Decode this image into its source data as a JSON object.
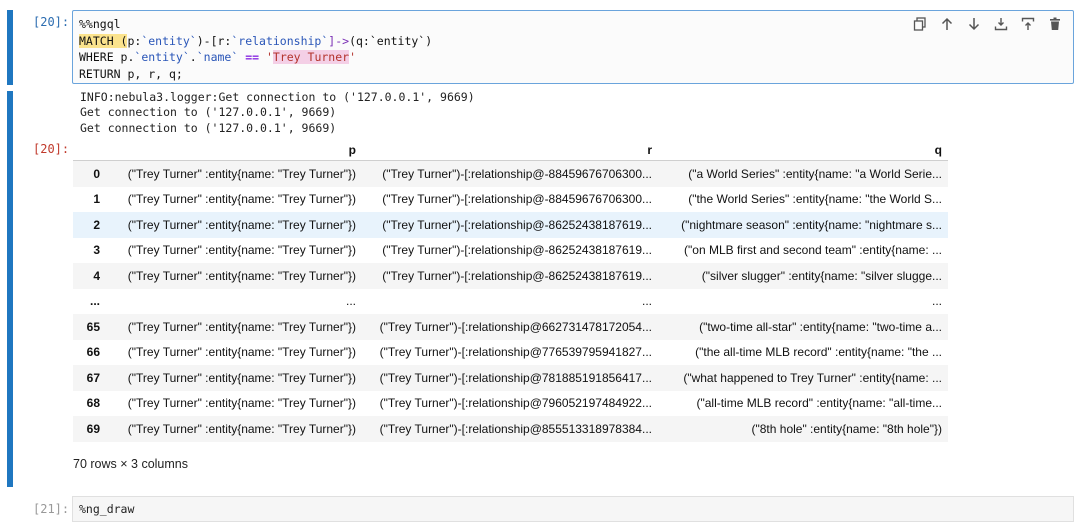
{
  "cell20": {
    "prompt": "[20]:",
    "code": {
      "line1": "%%ngql",
      "line2_match": "MATCH (",
      "line2_p": "p:",
      "line2_entity1": "`entity`",
      "line2_mid": ")-[r:",
      "line2_rel": "`relationship`",
      "line2_arrow": "]->",
      "line2_q": "(q:",
      "line2_entity2": "`entity`",
      "line2_close": ")",
      "line3_where": "WHERE p.",
      "line3_entity": "`entity`",
      "line3_dot": ".",
      "line3_name": "`name`",
      "line3_eq": " == ",
      "line3_q1": "'",
      "line3_value": "Trey Turner",
      "line3_q2": "'",
      "line4": "RETURN p, r, q;"
    },
    "toolbar": {
      "icons": [
        "duplicate-icon",
        "move-up-icon",
        "move-down-icon",
        "insert-above-icon",
        "insert-below-icon",
        "delete-icon"
      ]
    },
    "log": {
      "line1": "INFO:nebula3.logger:Get connection to ('127.0.0.1', 9669)",
      "line2": "Get connection to ('127.0.0.1', 9669)",
      "line3": "Get connection to ('127.0.0.1', 9669)"
    },
    "out_prompt": "[20]:",
    "table": {
      "columns": [
        "",
        "p",
        "r",
        "q"
      ],
      "rows": [
        [
          "0",
          "(\"Trey Turner\" :entity{name: \"Trey Turner\"})",
          "(\"Trey Turner\")-[:relationship@-88459676706300...",
          "(\"a World Series\" :entity{name: \"a World Serie..."
        ],
        [
          "1",
          "(\"Trey Turner\" :entity{name: \"Trey Turner\"})",
          "(\"Trey Turner\")-[:relationship@-88459676706300...",
          "(\"the World Series\" :entity{name: \"the World S..."
        ],
        [
          "2",
          "(\"Trey Turner\" :entity{name: \"Trey Turner\"})",
          "(\"Trey Turner\")-[:relationship@-86252438187619...",
          "(\"nightmare season\" :entity{name: \"nightmare s..."
        ],
        [
          "3",
          "(\"Trey Turner\" :entity{name: \"Trey Turner\"})",
          "(\"Trey Turner\")-[:relationship@-86252438187619...",
          "(\"on MLB first and second team\" :entity{name: ..."
        ],
        [
          "4",
          "(\"Trey Turner\" :entity{name: \"Trey Turner\"})",
          "(\"Trey Turner\")-[:relationship@-86252438187619...",
          "(\"silver slugger\" :entity{name: \"silver slugge..."
        ],
        [
          "...",
          "...",
          "...",
          "..."
        ],
        [
          "65",
          "(\"Trey Turner\" :entity{name: \"Trey Turner\"})",
          "(\"Trey Turner\")-[:relationship@662731478172054...",
          "(\"two-time all-star\" :entity{name: \"two-time a..."
        ],
        [
          "66",
          "(\"Trey Turner\" :entity{name: \"Trey Turner\"})",
          "(\"Trey Turner\")-[:relationship@776539795941827...",
          "(\"the all-time MLB record\" :entity{name: \"the ..."
        ],
        [
          "67",
          "(\"Trey Turner\" :entity{name: \"Trey Turner\"})",
          "(\"Trey Turner\")-[:relationship@781885191856417...",
          "(\"what happened to Trey Turner\" :entity{name: ..."
        ],
        [
          "68",
          "(\"Trey Turner\" :entity{name: \"Trey Turner\"})",
          "(\"Trey Turner\")-[:relationship@796052197484922...",
          "(\"all-time MLB record\" :entity{name: \"all-time..."
        ],
        [
          "69",
          "(\"Trey Turner\" :entity{name: \"Trey Turner\"})",
          "(\"Trey Turner\")-[:relationship@855513318978384...",
          "(\"8th hole\" :entity{name: \"8th hole\"})"
        ]
      ],
      "hover_row_index": 2
    },
    "shape": "70 rows × 3 columns"
  },
  "cell21": {
    "prompt": "[21]:",
    "code": "%ng_draw"
  },
  "colors": {
    "accent": "#1f77c0",
    "hover_row": "#e8f3fc",
    "highlight_yellow": "#fbe38d",
    "highlight_pink": "#f4cfe6"
  }
}
